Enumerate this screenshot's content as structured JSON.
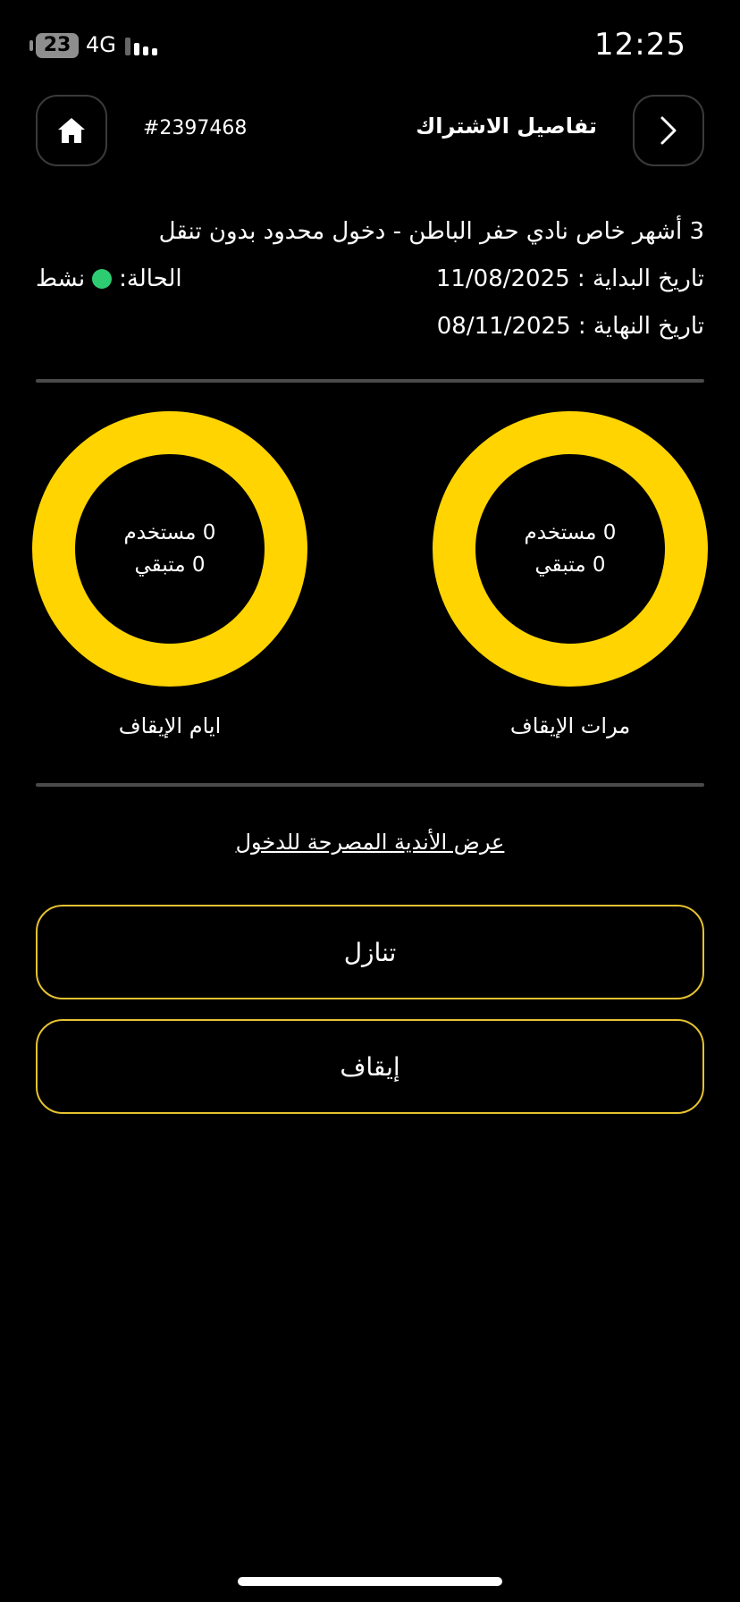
{
  "status_bar": {
    "battery": "23",
    "network": "4G",
    "time": "12:25"
  },
  "header": {
    "subscription_id": "#2397468",
    "title": "تفاصيل الاشتراك"
  },
  "subscription": {
    "plan_name": "3 أشهر خاص نادي حفر الباطن - دخول محدود بدون تنقل",
    "start_date": "تاريخ البداية : 11/08/2025",
    "end_date": "تاريخ النهاية : 08/11/2025",
    "status_label": "الحالة:",
    "status_value": "نشط",
    "status_color": "#2ecc71"
  },
  "freeze_days": {
    "used": "0 مستخدم",
    "remaining": "0 متبقي",
    "caption": "ايام الإيقاف"
  },
  "freeze_times": {
    "used": "0 مستخدم",
    "remaining": "0 متبقي",
    "caption": "مرات الإيقاف"
  },
  "links": {
    "allowed_clubs": "عرض الأندية المصرحة للدخول"
  },
  "actions": {
    "waive": "تنازل",
    "freeze": "إيقاف"
  },
  "colors": {
    "accent": "#ffd400",
    "background": "#000000",
    "button_border": "#e5c230"
  }
}
